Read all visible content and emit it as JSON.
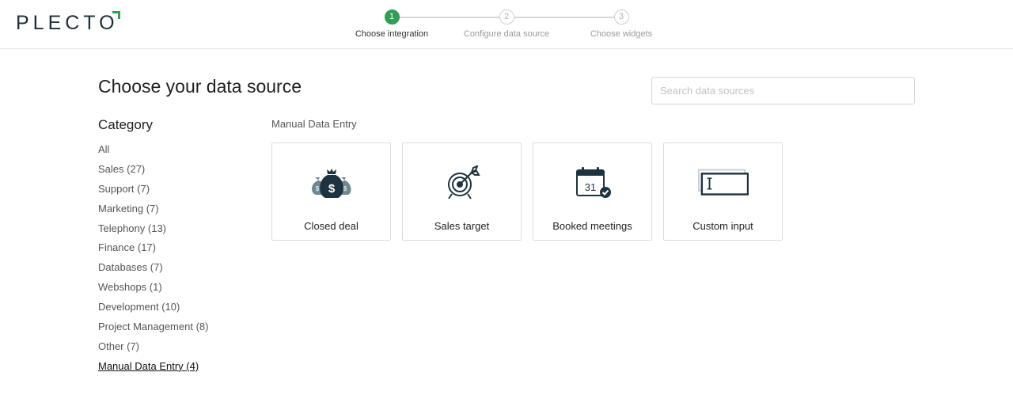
{
  "brand": {
    "logo_text": "PLECTO",
    "accent_color": "#2f9f55",
    "dark_color": "#1d2f38"
  },
  "stepper": {
    "steps": [
      {
        "number": "1",
        "label": "Choose integration",
        "state": "active"
      },
      {
        "number": "2",
        "label": "Configure data source",
        "state": "inactive"
      },
      {
        "number": "3",
        "label": "Choose widgets",
        "state": "inactive"
      }
    ]
  },
  "main": {
    "title": "Choose your data source",
    "search": {
      "placeholder": "Search data sources",
      "value": ""
    }
  },
  "sidebar": {
    "heading": "Category",
    "items": [
      {
        "label": "All"
      },
      {
        "label": "Sales (27)"
      },
      {
        "label": "Support (7)"
      },
      {
        "label": "Marketing (7)"
      },
      {
        "label": "Telephony (13)"
      },
      {
        "label": "Finance (17)"
      },
      {
        "label": "Databases (7)"
      },
      {
        "label": "Webshops (1)"
      },
      {
        "label": "Development (10)"
      },
      {
        "label": "Project Management (8)"
      },
      {
        "label": "Other (7)"
      },
      {
        "label": "Manual Data Entry (4)",
        "selected": true
      }
    ]
  },
  "section": {
    "label": "Manual Data Entry",
    "cards": [
      {
        "label": "Closed deal",
        "icon": "money-bags-icon"
      },
      {
        "label": "Sales target",
        "icon": "target-icon"
      },
      {
        "label": "Booked meetings",
        "icon": "calendar-check-icon",
        "icon_text": "31"
      },
      {
        "label": "Custom input",
        "icon": "text-input-icon"
      }
    ]
  }
}
